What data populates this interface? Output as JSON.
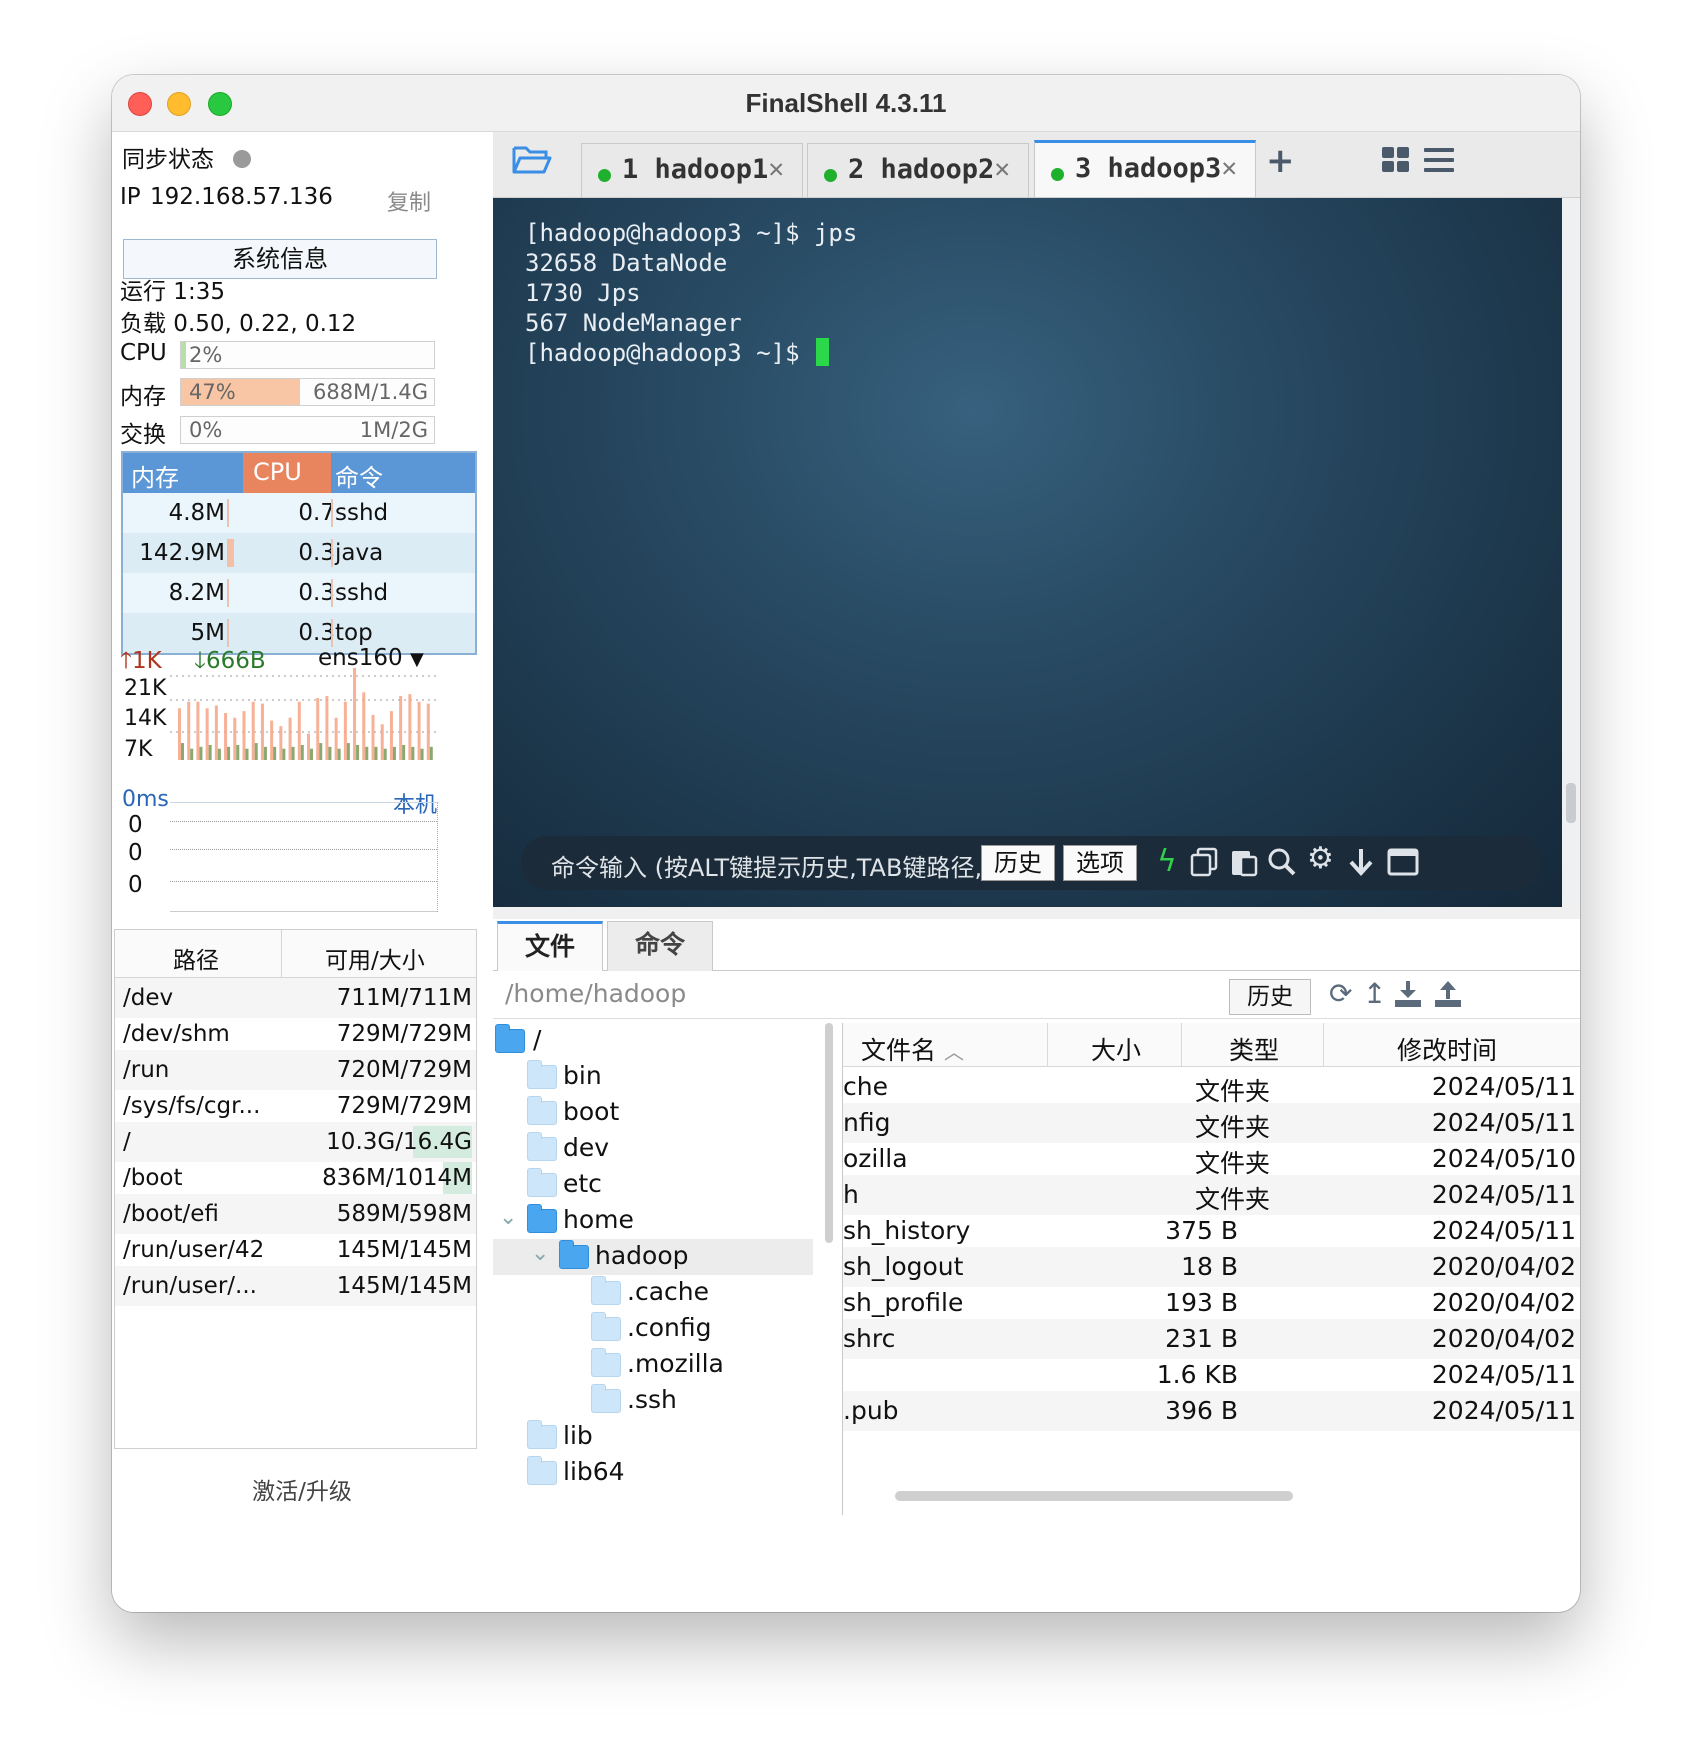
{
  "app": {
    "title": "FinalShell 4.3.11"
  },
  "left": {
    "sync_label": "同步状态",
    "ip_label": "IP",
    "ip": "192.168.57.136",
    "copy": "复制",
    "sysinfo_button": "系统信息",
    "uptime": "运行 1:35",
    "load": "负载 0.50, 0.22, 0.12",
    "cpu": {
      "label": "CPU",
      "percent": "2%",
      "fraction": 0.02
    },
    "memory": {
      "label": "内存",
      "percent": "47%",
      "amount": "688M/1.4G",
      "fraction": 0.47
    },
    "swap": {
      "label": "交换",
      "percent": "0%",
      "amount": "1M/2G",
      "fraction": 0.0
    },
    "process_table": {
      "headers": [
        "内存",
        "CPU",
        "命令"
      ],
      "rows": [
        {
          "mem": "4.8M",
          "cpu": "0.7",
          "cmd": "sshd"
        },
        {
          "mem": "142.9M",
          "cpu": "0.3",
          "cmd": "java"
        },
        {
          "mem": "8.2M",
          "cpu": "0.3",
          "cmd": "sshd"
        },
        {
          "mem": "5M",
          "cpu": "0.3",
          "cmd": "top"
        }
      ]
    },
    "network": {
      "up": "1K",
      "down": "666B",
      "interface": "ens160",
      "y_labels": [
        "21K",
        "14K",
        "7K"
      ],
      "up_series": [
        0.55,
        0.62,
        0.62,
        0.55,
        0.58,
        0.5,
        0.45,
        0.52,
        0.62,
        0.6,
        0.42,
        0.36,
        0.45,
        0.62,
        0.28,
        0.66,
        0.68,
        0.45,
        0.62,
        0.98,
        0.72,
        0.48,
        0.38,
        0.52,
        0.68,
        0.7,
        0.62,
        0.6
      ],
      "down_series": [
        0.18,
        0.12,
        0.14,
        0.16,
        0.12,
        0.14,
        0.16,
        0.12,
        0.18,
        0.14,
        0.14,
        0.12,
        0.14,
        0.16,
        0.12,
        0.18,
        0.14,
        0.12,
        0.18,
        0.16,
        0.14,
        0.14,
        0.12,
        0.14,
        0.16,
        0.14,
        0.12,
        0.14
      ]
    },
    "latency": {
      "value": "0ms",
      "host": "本机",
      "labels": [
        "0",
        "0",
        "0"
      ]
    },
    "disk_table": {
      "headers": [
        "路径",
        "可用/大小"
      ],
      "rows": [
        {
          "path": "/dev",
          "size": "711M/711M",
          "used_fraction": 0.0
        },
        {
          "path": "/dev/shm",
          "size": "729M/729M",
          "used_fraction": 0.0
        },
        {
          "path": "/run",
          "size": "720M/729M",
          "used_fraction": 0.0
        },
        {
          "path": "/sys/fs/cgr...",
          "size": "729M/729M",
          "used_fraction": 0.0
        },
        {
          "path": "/",
          "size": "10.3G/16.4G",
          "used_fraction": 0.37
        },
        {
          "path": "/boot",
          "size": "836M/1014M",
          "used_fraction": 0.18
        },
        {
          "path": "/boot/efi",
          "size": "589M/598M",
          "used_fraction": 0.0
        },
        {
          "path": "/run/user/42",
          "size": "145M/145M",
          "used_fraction": 0.0
        },
        {
          "path": "/run/user/...",
          "size": "145M/145M",
          "used_fraction": 0.0
        }
      ]
    },
    "activate": "激活/升级"
  },
  "tabs": [
    {
      "label": "1 hadoop1",
      "active": false
    },
    {
      "label": "2 hadoop2",
      "active": false
    },
    {
      "label": "3 hadoop3",
      "active": true
    }
  ],
  "terminal": {
    "lines": [
      "[hadoop@hadoop3 ~]$ jps",
      "32658 DataNode",
      "1730 Jps",
      "567 NodeManager"
    ],
    "prompt": "[hadoop@hadoop3 ~]$ ",
    "command_hint": "命令输入 (按ALT键提示历史,TAB键路径,E",
    "history_button": "历史",
    "options_button": "选项"
  },
  "file_manager": {
    "tabs": [
      "文件",
      "命令"
    ],
    "path": "/home/hadoop",
    "history_button": "历史",
    "tree": [
      {
        "name": "/",
        "level": 0,
        "open": true
      },
      {
        "name": "bin",
        "level": 1
      },
      {
        "name": "boot",
        "level": 1
      },
      {
        "name": "dev",
        "level": 1
      },
      {
        "name": "etc",
        "level": 1
      },
      {
        "name": "home",
        "level": 1,
        "open": true,
        "expanded": true
      },
      {
        "name": "hadoop",
        "level": 2,
        "open": true,
        "expanded": true,
        "selected": true
      },
      {
        "name": ".cache",
        "level": 3
      },
      {
        "name": ".config",
        "level": 3
      },
      {
        "name": ".mozilla",
        "level": 3
      },
      {
        "name": ".ssh",
        "level": 3
      },
      {
        "name": "lib",
        "level": 1
      },
      {
        "name": "lib64",
        "level": 1
      }
    ],
    "columns": [
      "文件名",
      "大小",
      "类型",
      "修改时间"
    ],
    "files": [
      {
        "name": "che",
        "size": "",
        "type": "文件夹",
        "date": "2024/05/11"
      },
      {
        "name": "nfig",
        "size": "",
        "type": "文件夹",
        "date": "2024/05/11"
      },
      {
        "name": "ozilla",
        "size": "",
        "type": "文件夹",
        "date": "2024/05/10"
      },
      {
        "name": "h",
        "size": "",
        "type": "文件夹",
        "date": "2024/05/11"
      },
      {
        "name": "sh_history",
        "size": "375 B",
        "type": "",
        "date": "2024/05/11"
      },
      {
        "name": "sh_logout",
        "size": "18 B",
        "type": "",
        "date": "2020/04/02"
      },
      {
        "name": "sh_profile",
        "size": "193 B",
        "type": "",
        "date": "2020/04/02"
      },
      {
        "name": "shrc",
        "size": "231 B",
        "type": "",
        "date": "2020/04/02"
      },
      {
        "name": "",
        "size": "1.6 KB",
        "type": "",
        "date": "2024/05/11"
      },
      {
        "name": ".pub",
        "size": "396 B",
        "type": "",
        "date": "2024/05/11"
      }
    ]
  },
  "colors": {
    "accent": "#3a8ee6",
    "memory_fill": "#f8c5a5",
    "cpu_fill": "#b9dfa8",
    "terminal_bg": "#284a63",
    "online_dot": "#1fb02e",
    "cursor": "#2bd84a",
    "net_up": "#f4a384",
    "net_down": "#8aa870"
  }
}
